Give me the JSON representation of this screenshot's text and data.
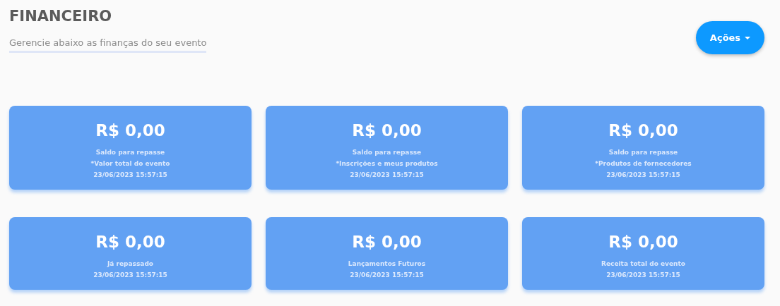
{
  "header": {
    "title": "FINANCEIRO",
    "subtitle": "Gerencie abaixo as finanças do seu evento"
  },
  "actions_button": {
    "label": "Ações"
  },
  "cards": [
    {
      "amount": "R$ 0,00",
      "lines": [
        "Saldo para repasse",
        "*Valor total do evento",
        "23/06/2023 15:57:15"
      ]
    },
    {
      "amount": "R$ 0,00",
      "lines": [
        "Saldo para repasse",
        "*Inscrições e meus produtos",
        "23/06/2023 15:57:15"
      ]
    },
    {
      "amount": "R$ 0,00",
      "lines": [
        "Saldo para repasse",
        "*Produtos de fornecedores",
        "23/06/2023 15:57:15"
      ]
    },
    {
      "amount": "R$ 0,00",
      "lines": [
        "Já repassado",
        "23/06/2023 15:57:15"
      ]
    },
    {
      "amount": "R$ 0,00",
      "lines": [
        "Lançamentos Futuros",
        "23/06/2023 15:57:15"
      ]
    },
    {
      "amount": "R$ 0,00",
      "lines": [
        "Receita total do evento",
        "23/06/2023 15:57:15"
      ]
    }
  ]
}
